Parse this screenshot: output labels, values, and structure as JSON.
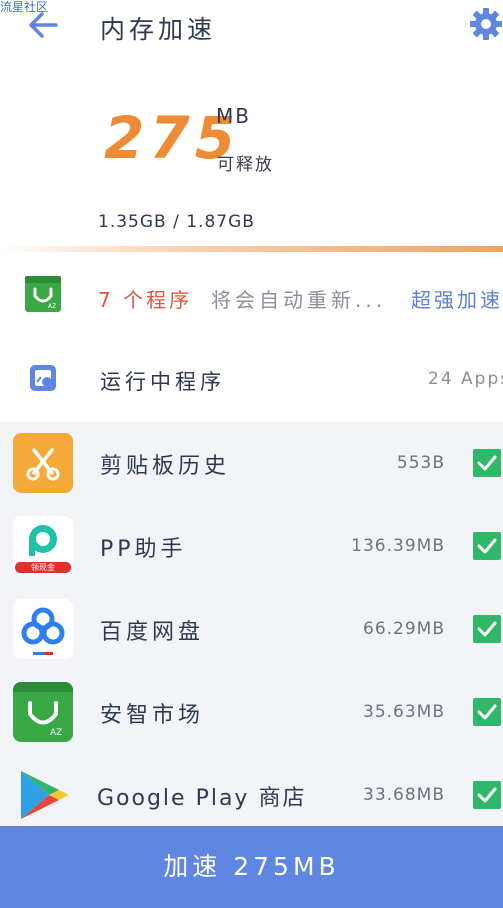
{
  "watermark": "流星社区",
  "header": {
    "title": "内存加速"
  },
  "release": {
    "amount": "275",
    "unit": "MB",
    "label": "可释放",
    "memory_usage": "1.35GB / 1.87GB"
  },
  "notice": {
    "count_text": "7 个程序",
    "text": "将会自动重新...",
    "link": "超强加速"
  },
  "running": {
    "label": "运行中程序",
    "count": "24 Apps"
  },
  "apps": [
    {
      "name": "剪贴板历史",
      "size": "553B",
      "checked": true,
      "icon": "scissors-icon"
    },
    {
      "name": "PP助手",
      "size": "136.39MB",
      "checked": true,
      "icon": "pp-assistant-icon",
      "badge": "领现金"
    },
    {
      "name": "百度网盘",
      "size": "66.29MB",
      "checked": true,
      "icon": "baidu-netdisk-icon"
    },
    {
      "name": "安智市场",
      "size": "35.63MB",
      "checked": true,
      "icon": "anzhi-market-icon"
    },
    {
      "name": "Google Play 商店",
      "size": "33.68MB",
      "checked": true,
      "icon": "google-play-icon"
    }
  ],
  "button": {
    "label": "加速 275MB"
  },
  "colors": {
    "accent": "#5f86e0",
    "release_orange": "#ef8a35",
    "notice_red": "#e2533b",
    "check_green": "#2fb76a",
    "list_bg": "#f3f4f8"
  }
}
